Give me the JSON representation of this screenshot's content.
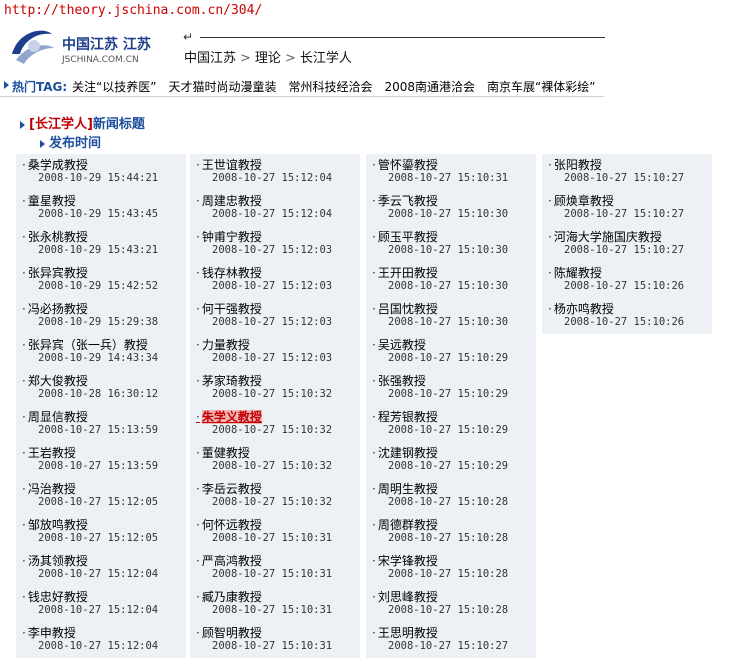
{
  "url": "http://theory.jschina.com.cn/304/",
  "logo": {
    "cn": "中国江苏 江苏",
    "en": "JSCHINA.COM.CN"
  },
  "back_icon": "back-arrow-icon",
  "breadcrumb": {
    "items": [
      "中国江苏",
      "理论",
      "长江学人"
    ],
    "sep": ">"
  },
  "hot": {
    "label": "热门TAG:",
    "items": [
      "关注“以技养医”",
      "天才猫时尚动漫童装",
      "常州科技经洽会",
      "2008南通港洽会",
      "南京车展“裸体彩绘”"
    ]
  },
  "section": {
    "bracket": "[长江学人]",
    "title": "新闻标题",
    "sub": "发布时间"
  },
  "colors": {
    "accent": "#1d4f9c",
    "red": "#c00000",
    "item_bg": "#edf1f6"
  },
  "columns": [
    [
      {
        "name": "桑学成教授",
        "date": "2008-10-29 15:44:21"
      },
      {
        "name": "童星教授",
        "date": "2008-10-29 15:43:45"
      },
      {
        "name": "张永桃教授",
        "date": "2008-10-29 15:43:21"
      },
      {
        "name": "张异宾教授",
        "date": "2008-10-29 15:42:52"
      },
      {
        "name": "冯必扬教授",
        "date": "2008-10-29 15:29:38"
      },
      {
        "name": "张异宾（张一兵）教授",
        "date": "2008-10-29 14:43:34"
      },
      {
        "name": "郑大俊教授",
        "date": "2008-10-28 16:30:12"
      },
      {
        "name": "周显信教授",
        "date": "2008-10-27 15:13:59"
      },
      {
        "name": "王岩教授",
        "date": "2008-10-27 15:13:59"
      },
      {
        "name": "冯治教授",
        "date": "2008-10-27 15:12:05"
      },
      {
        "name": "邹放鸣教授",
        "date": "2008-10-27 15:12:05"
      },
      {
        "name": "汤其领教授",
        "date": "2008-10-27 15:12:04"
      },
      {
        "name": "钱忠好教授",
        "date": "2008-10-27 15:12:04"
      },
      {
        "name": "李申教授",
        "date": "2008-10-27 15:12:04"
      }
    ],
    [
      {
        "name": "王世谊教授",
        "date": "2008-10-27 15:12:04"
      },
      {
        "name": "周建忠教授",
        "date": "2008-10-27 15:12:04"
      },
      {
        "name": "钟甫宁教授",
        "date": "2008-10-27 15:12:03"
      },
      {
        "name": "钱存林教授",
        "date": "2008-10-27 15:12:03"
      },
      {
        "name": "何干强教授",
        "date": "2008-10-27 15:12:03"
      },
      {
        "name": "力量教授",
        "date": "2008-10-27 15:12:03"
      },
      {
        "name": "茅家琦教授",
        "date": "2008-10-27 15:10:32"
      },
      {
        "name": "朱学义教授",
        "date": "2008-10-27 15:10:32",
        "hl": true
      },
      {
        "name": "董健教授",
        "date": "2008-10-27 15:10:32"
      },
      {
        "name": "李岳云教授",
        "date": "2008-10-27 15:10:32"
      },
      {
        "name": "何怀远教授",
        "date": "2008-10-27 15:10:31"
      },
      {
        "name": "严高鸿教授",
        "date": "2008-10-27 15:10:31"
      },
      {
        "name": "臧乃康教授",
        "date": "2008-10-27 15:10:31"
      },
      {
        "name": "顾智明教授",
        "date": "2008-10-27 15:10:31"
      }
    ],
    [
      {
        "name": "管怀鎏教授",
        "date": "2008-10-27 15:10:31"
      },
      {
        "name": "季云飞教授",
        "date": "2008-10-27 15:10:30"
      },
      {
        "name": "顾玉平教授",
        "date": "2008-10-27 15:10:30"
      },
      {
        "name": "王开田教授",
        "date": "2008-10-27 15:10:30"
      },
      {
        "name": "吕国忱教授",
        "date": "2008-10-27 15:10:30"
      },
      {
        "name": "吴远教授",
        "date": "2008-10-27 15:10:29"
      },
      {
        "name": "张强教授",
        "date": "2008-10-27 15:10:29"
      },
      {
        "name": "程芳银教授",
        "date": "2008-10-27 15:10:29"
      },
      {
        "name": "沈建钢教授",
        "date": "2008-10-27 15:10:29"
      },
      {
        "name": "周明生教授",
        "date": "2008-10-27 15:10:28"
      },
      {
        "name": "周德群教授",
        "date": "2008-10-27 15:10:28"
      },
      {
        "name": "宋学锋教授",
        "date": "2008-10-27 15:10:28"
      },
      {
        "name": "刘思峰教授",
        "date": "2008-10-27 15:10:28"
      },
      {
        "name": "王思明教授",
        "date": "2008-10-27 15:10:27"
      }
    ],
    [
      {
        "name": "张阳教授",
        "date": "2008-10-27 15:10:27"
      },
      {
        "name": "顾焕章教授",
        "date": "2008-10-27 15:10:27"
      },
      {
        "name": "河海大学施国庆教授",
        "date": "2008-10-27 15:10:27"
      },
      {
        "name": "陈耀教授",
        "date": "2008-10-27 15:10:26"
      },
      {
        "name": "杨亦鸣教授",
        "date": "2008-10-27 15:10:26"
      }
    ]
  ]
}
